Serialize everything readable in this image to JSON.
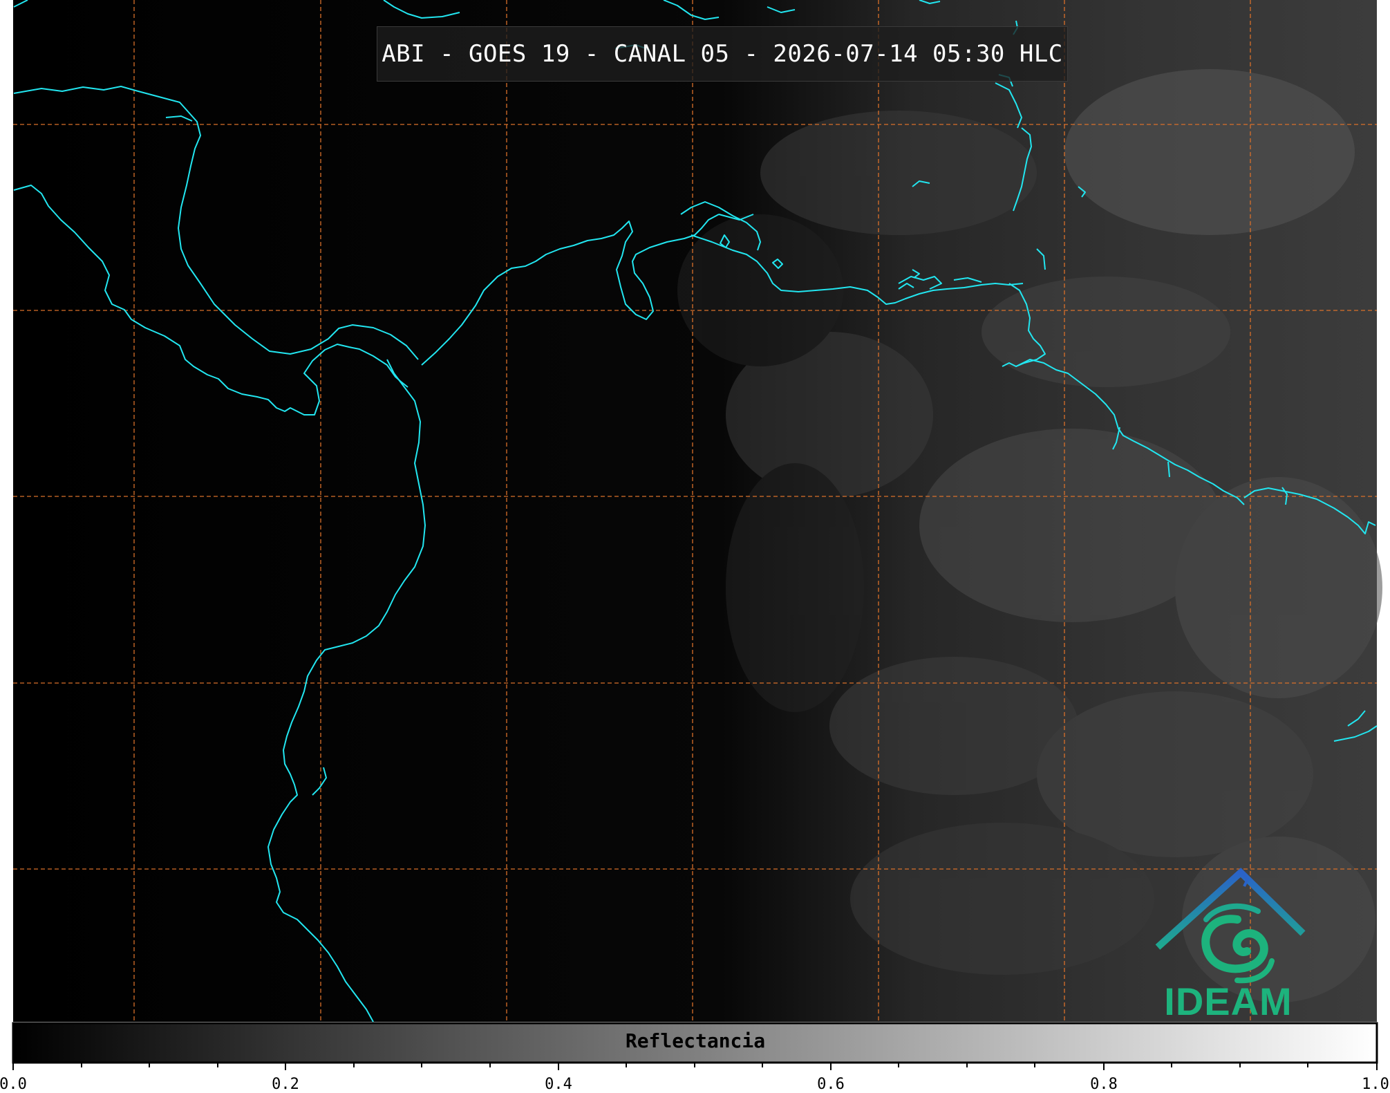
{
  "title": "ABI - GOES 19 - CANAL 05 - 2026-07-14 05:30 HLC",
  "colorbar": {
    "label": "Reflectancia",
    "ticks": [
      "0.0",
      "0.2",
      "0.4",
      "0.6",
      "0.8",
      "1.0"
    ],
    "range": [
      0.0,
      1.0
    ]
  },
  "logo": {
    "text": "IDEAM"
  },
  "colors": {
    "coastline": "#22e6f0",
    "grid": "#d9702a",
    "background": "#000000",
    "logo_blue": "#2a6fc4",
    "logo_green": "#1db37d"
  },
  "map": {
    "grid": "dashed",
    "coastline_icon": "coastline-path"
  }
}
